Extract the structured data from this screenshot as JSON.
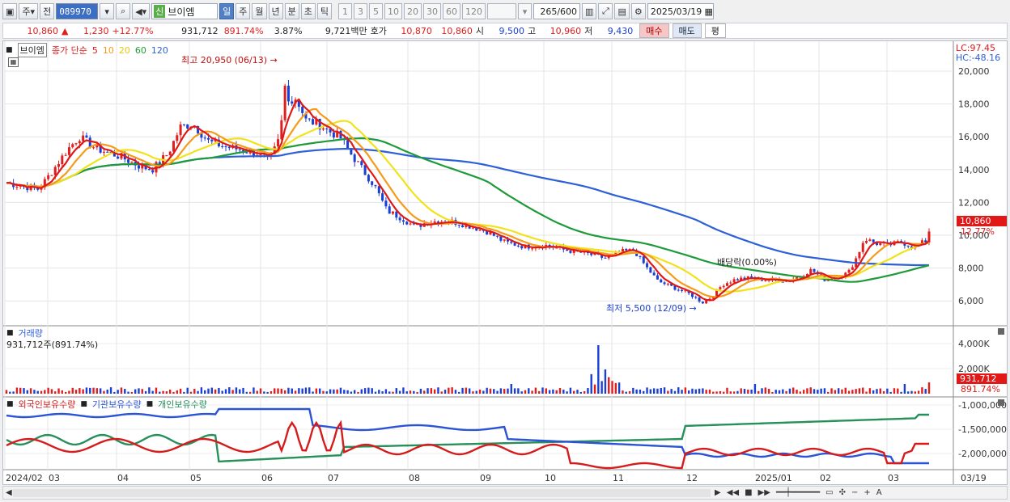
{
  "toolbar": {
    "period_main": "주",
    "prev_label": "전",
    "code": "089970",
    "stock_tag": "신",
    "stock_name": "브이엠",
    "period_tabs": [
      {
        "label": "일",
        "active": true
      },
      {
        "label": "주",
        "active": false
      },
      {
        "label": "월",
        "active": false
      },
      {
        "label": "년",
        "active": false
      },
      {
        "label": "분",
        "active": false
      },
      {
        "label": "초",
        "active": false
      },
      {
        "label": "틱",
        "active": false
      }
    ],
    "intervals": [
      "1",
      "3",
      "5",
      "10",
      "20",
      "30",
      "60",
      "120"
    ],
    "count": "265/600",
    "date": "2025/03/19"
  },
  "info": {
    "price": "10,860",
    "change_arrow": "▲",
    "change": "1,230",
    "change_pct": "+12.77%",
    "volume": "931,712",
    "volume_ratio": "891.74%",
    "turnover_rate": "3.87%",
    "trade_value": "9,721백만",
    "quote_label": "호가",
    "ask": "10,870",
    "bid": "10,860",
    "open_label": "시",
    "open": "9,500",
    "high_label": "고",
    "high": "10,960",
    "low_label": "저",
    "low": "9,430",
    "buy_label": "매수",
    "sell_label": "매도",
    "eval_label": "평"
  },
  "price_panel": {
    "name_box": "브이엠",
    "legend_prefix": "종가 단순",
    "ma": [
      {
        "label": "5",
        "color": "#e01818"
      },
      {
        "label": "10",
        "color": "#f59a1a"
      },
      {
        "label": "20",
        "color": "#f2e21a"
      },
      {
        "label": "60",
        "color": "#1f9a3a"
      },
      {
        "label": "120",
        "color": "#2d5fd8"
      }
    ],
    "high_note": "최고 20,950 (06/13)",
    "low_note": "최저 5,500 (12/09)",
    "dividend_note": "배당락(0.00%)",
    "lc_label": "LC:97.45",
    "hc_label": "HC:-48.16",
    "current_price_tag": "10,860",
    "current_pct_tag": "12.77%",
    "y_ticks": [
      "20,000",
      "18,000",
      "16,000",
      "14,000",
      "12,000",
      "10,000",
      "8,000",
      "6,000"
    ]
  },
  "volume_panel": {
    "title": "거래량",
    "sub": "931,712주(891.74%)",
    "y_ticks": [
      "4,000K",
      "2,000K"
    ],
    "tag_value": "931,712",
    "tag_pct": "891.74%"
  },
  "holding_panel": {
    "series": [
      {
        "label": "외국인보유수량",
        "color": "#d51c1c"
      },
      {
        "label": "기관보유수량",
        "color": "#2a53d6"
      },
      {
        "label": "개인보유수량",
        "color": "#27905a"
      }
    ],
    "y_ticks": [
      "-1,000,000",
      "-1,500,000",
      "-2,000,000"
    ]
  },
  "x_axis": {
    "labels": [
      "2024/02",
      "03",
      "04",
      "05",
      "06",
      "07",
      "08",
      "09",
      "10",
      "11",
      "12",
      "2025/01",
      "02",
      "03"
    ],
    "right_label": "03/19"
  },
  "colors": {
    "up": "#e11d1d",
    "down": "#1a3fd4",
    "ma5": "#e01818",
    "ma10": "#f59a1a",
    "ma20": "#f2e21a",
    "ma60": "#1f9a3a",
    "ma120": "#2d5fd8"
  }
}
